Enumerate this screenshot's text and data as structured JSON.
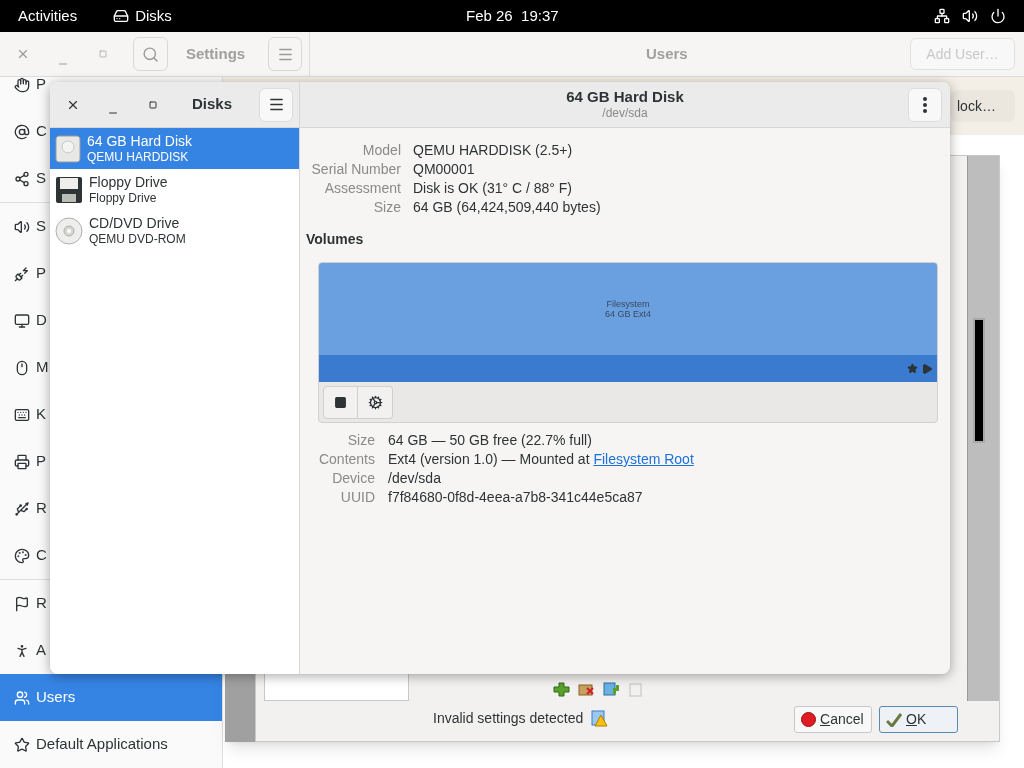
{
  "topbar": {
    "activities": "Activities",
    "app": "Disks",
    "clock": "Feb 26  19:37"
  },
  "settings": {
    "title": "Settings",
    "panel_title": "Users",
    "add_user": {
      "label": "Add User…",
      "disabled": true
    },
    "unlock": "lock…",
    "sidebar": [
      {
        "label": "P",
        "selected": false
      },
      {
        "label": "C",
        "selected": false
      },
      {
        "label": "S",
        "selected": false
      },
      {
        "label": "S",
        "selected": false
      },
      {
        "label": "P",
        "selected": false
      },
      {
        "label": "D",
        "selected": false
      },
      {
        "label": "M",
        "selected": false
      },
      {
        "label": "K",
        "selected": false
      },
      {
        "label": "P",
        "selected": false
      },
      {
        "label": "R",
        "selected": false
      },
      {
        "label": "C",
        "selected": false
      },
      {
        "label": "R",
        "selected": false
      },
      {
        "label": "A",
        "selected": false
      },
      {
        "label": "Users",
        "selected": true
      },
      {
        "label": "Default Applications",
        "selected": false
      }
    ]
  },
  "dialog": {
    "status": "Invalid settings detected",
    "buttons": [
      {
        "label": "Cancel",
        "kind": "cancel"
      },
      {
        "label": "OK",
        "kind": "ok"
      }
    ]
  },
  "disks": {
    "title": "Disks",
    "header": {
      "title": "64 GB Hard Disk",
      "subtitle": "/dev/sda"
    },
    "devices": [
      {
        "name": "64 GB Hard Disk",
        "model": "QEMU HARDDISK",
        "kind": "hdd",
        "selected": true
      },
      {
        "name": "Floppy Drive",
        "model": "Floppy Drive",
        "kind": "floppy",
        "selected": false
      },
      {
        "name": "CD/DVD Drive",
        "model": "QEMU DVD-ROM",
        "kind": "optical",
        "selected": false
      }
    ],
    "properties": [
      {
        "label": "Model",
        "value": "QEMU HARDDISK (2.5+)"
      },
      {
        "label": "Serial Number",
        "value": "QM00001"
      },
      {
        "label": "Assessment",
        "value": "Disk is OK (31° C / 88° F)"
      },
      {
        "label": "Size",
        "value": "64 GB (64,424,509,440 bytes)"
      }
    ],
    "volumes_heading": "Volumes",
    "volume": {
      "name": "Filesystem",
      "detail": "64 GB Ext4"
    },
    "volume_properties": [
      {
        "label": "Size",
        "value": "64 GB — 50 GB free (22.7% full)"
      },
      {
        "label": "Contents",
        "value": "Ext4 (version 1.0) — Mounted at ",
        "link": "Filesystem Root"
      },
      {
        "label": "Device",
        "value": "/dev/sda"
      },
      {
        "label": "UUID",
        "value": "f7f84680-0f8d-4eea-a7b8-341c44e5ca87"
      }
    ]
  }
}
